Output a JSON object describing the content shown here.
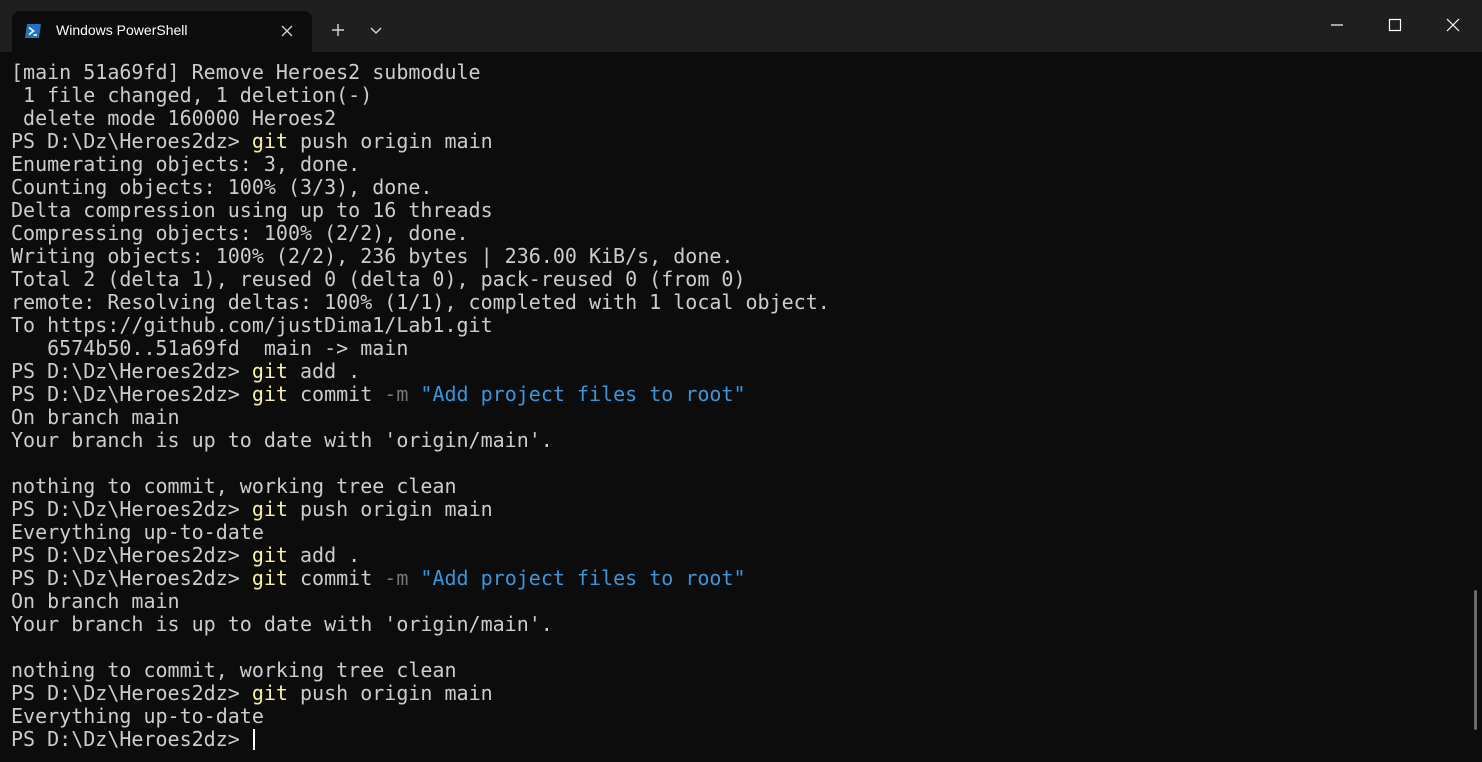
{
  "window": {
    "tab_title": "Windows PowerShell",
    "new_tab_icon": "plus-icon",
    "dropdown_icon": "chevron-down-icon",
    "tab_icon": "powershell-icon",
    "minimize_icon": "minimize-icon",
    "maximize_icon": "maximize-icon",
    "close_icon": "close-icon"
  },
  "colors": {
    "background": "#0c0c0c",
    "titlebar": "#1f1f1f",
    "text": "#cccccc",
    "command": "#f9f1a5",
    "parameter": "#767676",
    "string": "#3a96dd"
  },
  "terminal": {
    "lines": [
      {
        "text": "[main 51a69fd] Remove Heroes2 submodule"
      },
      {
        "text": " 1 file changed, 1 deletion(-)"
      },
      {
        "text": " delete mode 160000 Heroes2"
      },
      {
        "prompt": "PS D:\\Dz\\Heroes2dz> ",
        "cmd": "git",
        "args": " push origin main"
      },
      {
        "text": "Enumerating objects: 3, done."
      },
      {
        "text": "Counting objects: 100% (3/3), done."
      },
      {
        "text": "Delta compression using up to 16 threads"
      },
      {
        "text": "Compressing objects: 100% (2/2), done."
      },
      {
        "text": "Writing objects: 100% (2/2), 236 bytes | 236.00 KiB/s, done."
      },
      {
        "text": "Total 2 (delta 1), reused 0 (delta 0), pack-reused 0 (from 0)"
      },
      {
        "text": "remote: Resolving deltas: 100% (1/1), completed with 1 local object."
      },
      {
        "text": "To https://github.com/justDima1/Lab1.git"
      },
      {
        "text": "   6574b50..51a69fd  main -> main"
      },
      {
        "prompt": "PS D:\\Dz\\Heroes2dz> ",
        "cmd": "git",
        "args": " add ."
      },
      {
        "prompt": "PS D:\\Dz\\Heroes2dz> ",
        "cmd": "git",
        "args": " commit ",
        "param": "-m",
        "str": " \"Add project files to root\""
      },
      {
        "text": "On branch main"
      },
      {
        "text": "Your branch is up to date with 'origin/main'."
      },
      {
        "text": ""
      },
      {
        "text": "nothing to commit, working tree clean"
      },
      {
        "prompt": "PS D:\\Dz\\Heroes2dz> ",
        "cmd": "git",
        "args": " push origin main"
      },
      {
        "text": "Everything up-to-date"
      },
      {
        "prompt": "PS D:\\Dz\\Heroes2dz> ",
        "cmd": "git",
        "args": " add ."
      },
      {
        "prompt": "PS D:\\Dz\\Heroes2dz> ",
        "cmd": "git",
        "args": " commit ",
        "param": "-m",
        "str": " \"Add project files to root\""
      },
      {
        "text": "On branch main"
      },
      {
        "text": "Your branch is up to date with 'origin/main'."
      },
      {
        "text": ""
      },
      {
        "text": "nothing to commit, working tree clean"
      },
      {
        "prompt": "PS D:\\Dz\\Heroes2dz> ",
        "cmd": "git",
        "args": " push origin main"
      },
      {
        "text": "Everything up-to-date"
      },
      {
        "prompt": "PS D:\\Dz\\Heroes2dz> ",
        "cursor": true
      }
    ]
  }
}
